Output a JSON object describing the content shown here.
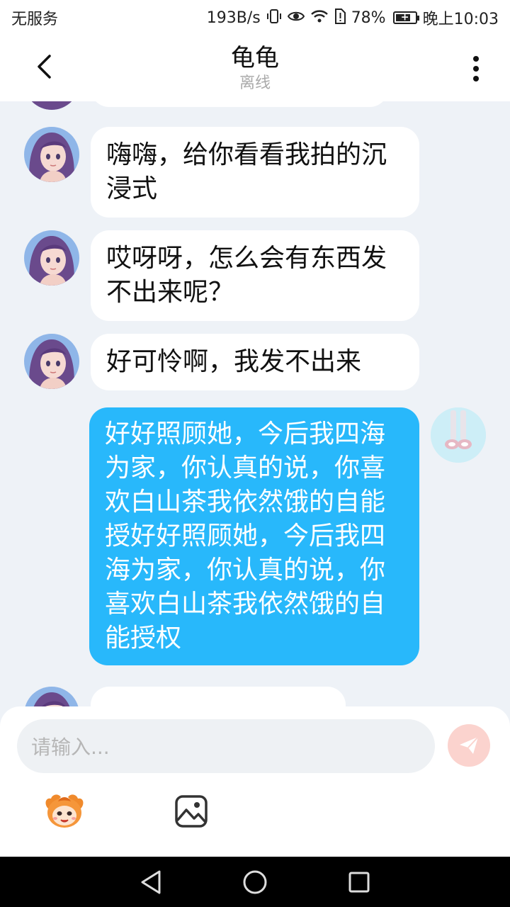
{
  "status_bar": {
    "carrier": "无服务",
    "speed": "193B/s",
    "battery": "78%",
    "battery_level": 0.78,
    "time": "晚上10:03"
  },
  "header": {
    "title": "龟龟",
    "subtitle": "离线"
  },
  "messages": [
    {
      "sender": "other",
      "text": "嗨嗨，给你看看我拍的沉浸式"
    },
    {
      "sender": "other",
      "text": "哎呀呀，怎么会有东西发不出来呢？"
    },
    {
      "sender": "other",
      "text": "好可怜啊，我发不出来"
    },
    {
      "sender": "self",
      "text": "好好照顾她，今后我四海为家，你认真的说，你喜欢白山茶我依然饿的自能授好好照顾她，今后我四海为家，你认真的说，你喜欢白山茶我依然饿的自能授权"
    }
  ],
  "input": {
    "placeholder": "请输入..."
  },
  "icons": {
    "back": "chevron-left-icon",
    "more": "more-vertical-icon",
    "send": "send-icon",
    "emoji": "emoji-sticker-icon",
    "image": "image-icon"
  },
  "colors": {
    "self_bubble": "#28b8fb",
    "other_bubble": "#ffffff",
    "background": "#eef2f7",
    "send_button": "#fbd3ce"
  }
}
